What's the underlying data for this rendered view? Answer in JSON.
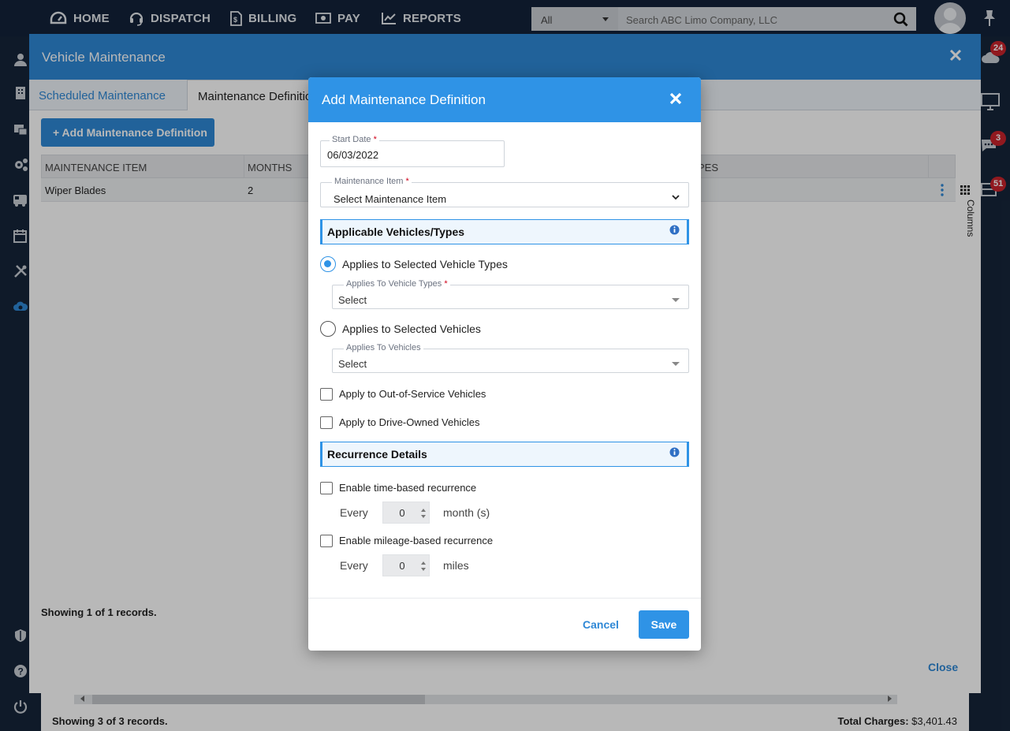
{
  "nav": {
    "items": [
      {
        "label": "HOME",
        "icon": "dashboard-icon"
      },
      {
        "label": "DISPATCH",
        "icon": "headset-icon"
      },
      {
        "label": "BILLING",
        "icon": "invoice-icon"
      },
      {
        "label": "PAY",
        "icon": "money-icon"
      },
      {
        "label": "REPORTS",
        "icon": "chart-icon"
      }
    ],
    "search_category": "All",
    "search_placeholder": "Search ABC Limo Company, LLC"
  },
  "right_rail": {
    "badges": [
      "24",
      "3",
      "51"
    ]
  },
  "background": {
    "title": "Vehicle Maintenance",
    "tabs": [
      "Scheduled Maintenance",
      "Maintenance Definitions"
    ],
    "add_button": "+ Add Maintenance Definition",
    "columns": [
      "MAINTENANCE ITEM",
      "MONTHS",
      "PES"
    ],
    "rows": [
      {
        "item": "Wiper Blades",
        "months": "2"
      }
    ],
    "showing": "Showing 1 of 1 records.",
    "close_link": "Close",
    "columns_toggle": "Columns",
    "footer_showing": "Showing 3 of 3 records.",
    "total_label": "Total Charges:",
    "total_value": "$3,401.43"
  },
  "dialog": {
    "title": "Add Maintenance Definition",
    "start_date": {
      "label": "Start Date",
      "value": "06/03/2022"
    },
    "maintenance_item": {
      "label": "Maintenance Item",
      "value": "Select Maintenance Item"
    },
    "section_vehicles": "Applicable Vehicles/Types",
    "radio_types": "Applies to Selected Vehicle Types",
    "vehicle_types": {
      "label": "Applies To Vehicle Types",
      "value": "Select"
    },
    "radio_vehicles": "Applies to Selected Vehicles",
    "vehicles": {
      "label": "Applies To Vehicles",
      "value": "Select"
    },
    "check_out_of_service": "Apply to Out-of-Service Vehicles",
    "check_driver_owned": "Apply to Drive-Owned Vehicles",
    "section_recurrence": "Recurrence Details",
    "check_time": "Enable time-based recurrence",
    "time_every": "Every",
    "time_value": "0",
    "time_unit": "month (s)",
    "check_mileage": "Enable mileage-based recurrence",
    "mileage_every": "Every",
    "mileage_value": "0",
    "mileage_unit": "miles",
    "cancel": "Cancel",
    "save": "Save"
  }
}
